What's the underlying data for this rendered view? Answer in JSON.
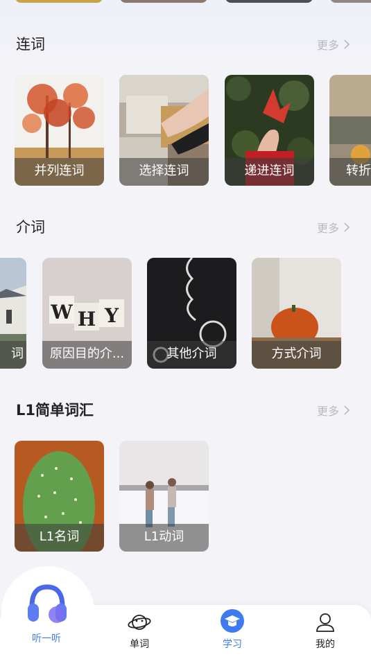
{
  "sections": [
    {
      "title": "连词",
      "more_label": "更多",
      "cards": [
        {
          "label": "并列连词"
        },
        {
          "label": "选择连词"
        },
        {
          "label": "递进连词"
        },
        {
          "label": "转折连词"
        }
      ]
    },
    {
      "title": "介词",
      "more_label": "更多",
      "cards": [
        {
          "label": "词"
        },
        {
          "label": "原因目的介..."
        },
        {
          "label": "其他介词"
        },
        {
          "label": "方式介词"
        }
      ]
    },
    {
      "title": "L1简单词汇",
      "more_label": "更多",
      "cards": [
        {
          "label": "L1名词"
        },
        {
          "label": "L1动词"
        }
      ]
    }
  ],
  "card_letters": {
    "w": "W",
    "h": "H",
    "y": "Y"
  },
  "nav": {
    "listen": {
      "label": "听一听",
      "icon": "headphones-icon"
    },
    "items": [
      {
        "label": "单词",
        "icon": "planet-icon"
      },
      {
        "label": "学习",
        "icon": "graduation-cap-icon",
        "active": true
      },
      {
        "label": "我的",
        "icon": "person-icon"
      }
    ]
  },
  "colors": {
    "accent": "#3f7bf0",
    "background": "#f4f4f8",
    "muted": "#b8b8bf"
  }
}
